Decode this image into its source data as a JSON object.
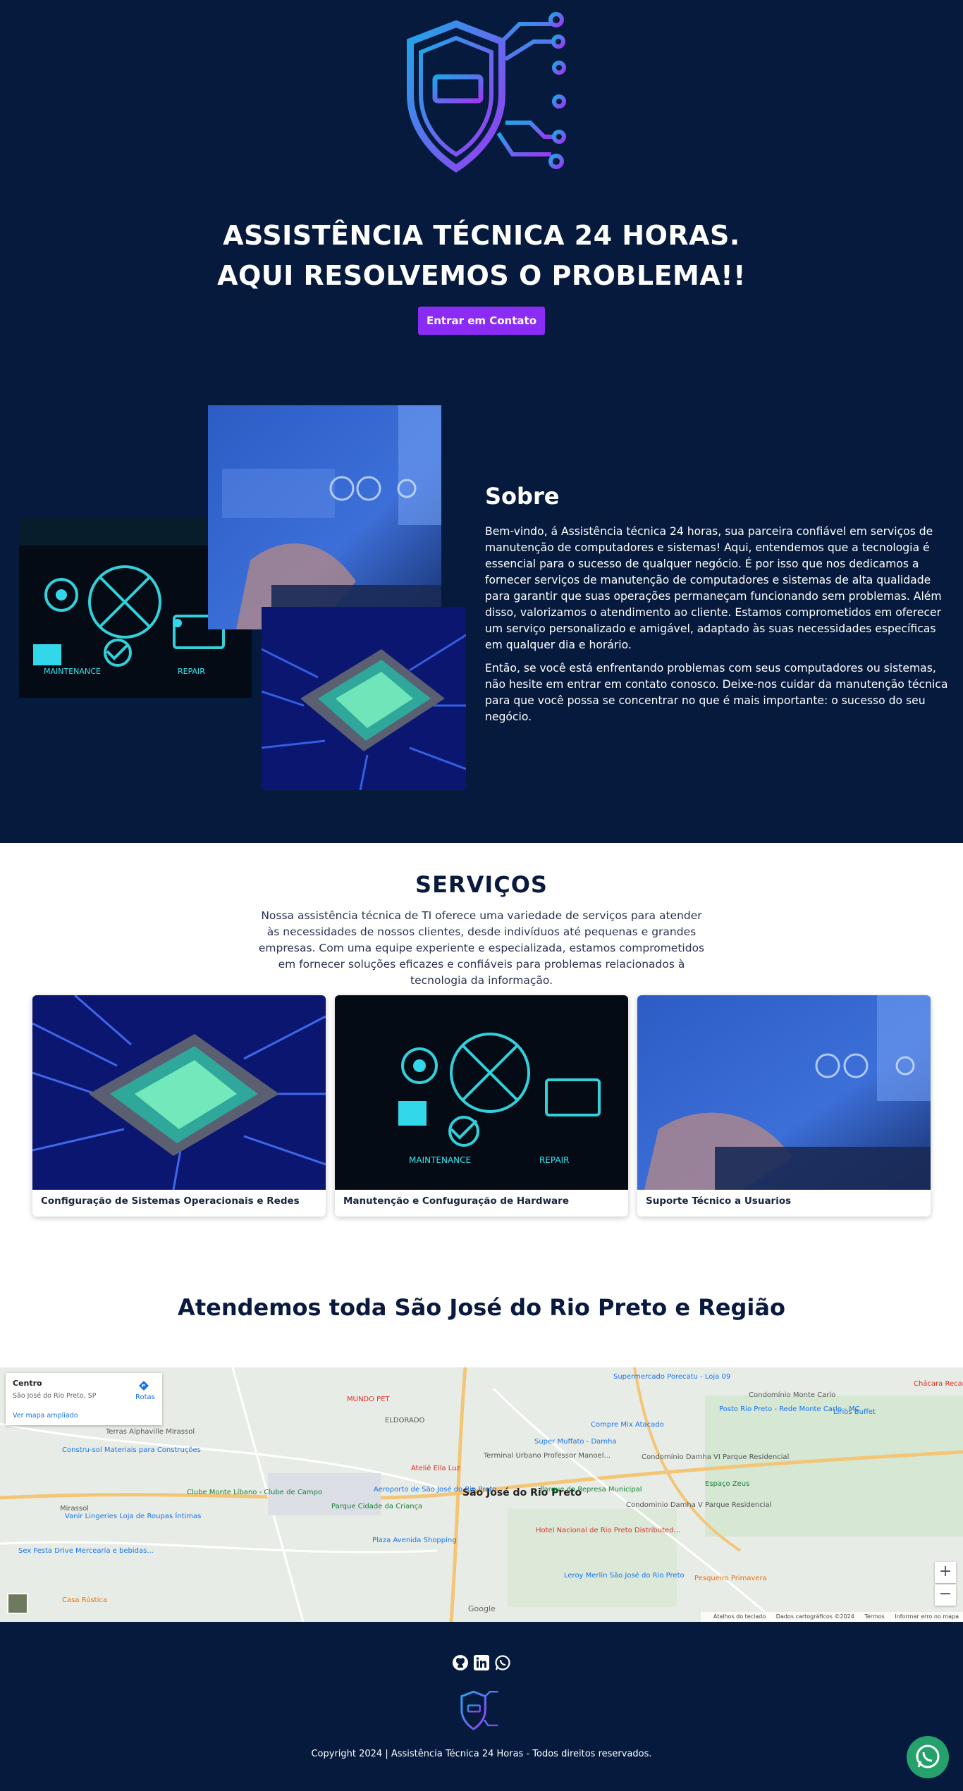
{
  "hero": {
    "title_line1": "ASSISTÊNCIA TÉCNICA 24 HORAS.",
    "title_line2": "AQUI RESOLVEMOS O PROBLEMA!!",
    "cta_label": "Entrar em Contato"
  },
  "about": {
    "title": "Sobre",
    "paragraph1": "Bem-vindo, á Assistência técnica 24 horas, sua parceira confiável em serviços de manutenção de computadores e sistemas! Aqui, entendemos que a tecnologia é essencial para o sucesso de qualquer negócio. É por isso que nos dedicamos a fornecer serviços de manutenção de computadores e sistemas de alta qualidade para garantir que suas operações permaneçam funcionando sem problemas. Além disso, valorizamos o atendimento ao cliente. Estamos comprometidos em oferecer um serviço personalizado e amigável, adaptado às suas necessidades específicas em qualquer dia e horário.",
    "paragraph2": "Então, se você está enfrentando problemas com seus computadores ou sistemas, não hesite em entrar em contato conosco. Deixe-nos cuidar da manutenção técnica para que você possa se concentrar no que é mais importante: o sucesso do seu negócio."
  },
  "services": {
    "title": "SERVIÇOS",
    "description": "Nossa assistência técnica de TI oferece uma variedade de serviços para atender às necessidades de nossos clientes, desde indivíduos até pequenas e grandes empresas. Com uma equipe experiente e especializada, estamos comprometidos em fornecer soluções eficazes e confiáveis para problemas relacionados à tecnologia da informação.",
    "cards": [
      {
        "label": "Configuração de Sistemas Operacionais e Redes"
      },
      {
        "label": "Manutenção e Confuguração de Hardware"
      },
      {
        "label": "Suporte Técnico a Usuarios"
      }
    ]
  },
  "region": {
    "title": "Atendemos toda São José do Rio Preto e Região"
  },
  "map": {
    "place_name": "Centro",
    "place_address": "São José do Rio Preto, SP",
    "larger_map_link": "Ver mapa ampliado",
    "routes_label": "Rotas",
    "zoom_in": "+",
    "zoom_out": "−",
    "city_label": "São José do Rio Preto",
    "footer": {
      "shortcuts": "Atalhos do teclado",
      "data": "Dados cartográficos ©2024",
      "terms": "Termos",
      "report": "Informar erro no mapa"
    },
    "google": "Google",
    "labels": {
      "eldorado": "ELDORADO",
      "mirassol": "Mirassol",
      "mundo_pet": "MUNDO PET",
      "supermercado_porecatu": "Supermercado Porecatu - Loja 09",
      "compre_mix": "Compre Mix Atacado",
      "super_muffato": "Super Muffato - Damha",
      "atelie": "Ateliê Ella Luz",
      "aeroporto": "Aeroporto de São José do Rio Preto",
      "parque_cidade": "Parque Cidade da Criança",
      "represa": "Parque da Represa Municipal",
      "hotel": "Hotel Nacional de Rio Preto Distributed...",
      "plaza": "Plaza Avenida Shopping",
      "leroy": "Leroy Merlin São José do Rio Preto",
      "terras": "Terras Alphaville Mirassol",
      "construsol": "Constru-sol Materiais para Construções",
      "clube": "Clube Monte Líbano - Clube de Campo",
      "vanir": "Vanir Lingeries Loja de Roupas Íntimas",
      "sexfesta": "Sex Festa Drive Mercearia e bebidas...",
      "casa_rustica": "Casa Rústica",
      "posto": "Posto Rio Preto - Rede Monte Carlo - MC",
      "lirios": "Lírios Buffet",
      "condominio_monte_carlo": "Condomínio Monte Carlo",
      "damha_vi": "Condomínio Damha VI Parque Residencial",
      "damha_v": "Condominio Damha V Parque Residencial",
      "espaco_zeus": "Espaço Zeus",
      "pesqueiro": "Pesqueiro Primavera",
      "chacara": "Chácara Recanto dos Amigos",
      "terminal": "Terminal Urbano Professor Manoel..."
    }
  },
  "footer": {
    "copyright": "Copyright 2024 | Assistência Técnica 24 Horas - Todos direitos reservados."
  },
  "colors": {
    "navy": "#061a3d",
    "accent_purple": "#8b2cf5",
    "whatsapp_green": "#25a26c"
  }
}
